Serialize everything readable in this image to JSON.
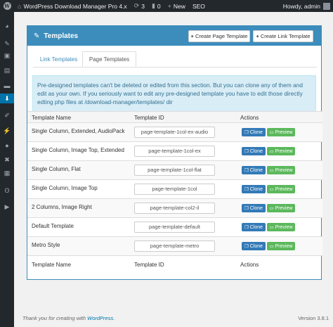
{
  "adminbar": {
    "site_title": "WordPress Download Manager Pro 4.x",
    "updates_count": "3",
    "comments_count": "0",
    "new_label": "New",
    "seo_label": "SEO",
    "howdy": "Howdy, admin"
  },
  "sidemenu": {
    "icons": [
      "dashboard-icon",
      "pin-icon",
      "media-icon",
      "pages-icon",
      "comments-icon",
      "download-manager-icon",
      "appearance-icon",
      "plugins-icon",
      "users-icon",
      "tools-icon",
      "settings-icon",
      "seo-icon",
      "collapse-icon"
    ]
  },
  "panel": {
    "title": "Templates",
    "create_page_template": "Create Page Template",
    "create_link_template": "Create Link Template"
  },
  "tabs": {
    "link_templates": "Link Templates",
    "page_templates": "Page Templates"
  },
  "info": {
    "text": "Pre-designed templates can't be deleted or edited from this section. But you can clone any of them and edit as your own. If you seriously want to edit any pre-designed template you have to edit those directly edting php files at /download-manager/templates/ dir"
  },
  "table": {
    "headers": {
      "name": "Template Name",
      "id": "Template ID",
      "actions": "Actions"
    },
    "clone_label": "Clone",
    "preview_label": "Preview",
    "rows": [
      {
        "name": "Single Column, Extended, AudioPack",
        "id": "page-template-1col-ex-audio"
      },
      {
        "name": "Single Column, Image Top, Extended",
        "id": "page-template-1col-ex"
      },
      {
        "name": "Single Column, Flat",
        "id": "page-template-1col-flat"
      },
      {
        "name": "Single Column, Image Top",
        "id": "page-template-1col"
      },
      {
        "name": "2 Columns, Image Right",
        "id": "page-template-col2-il"
      },
      {
        "name": "Default Template",
        "id": "page-template-default"
      },
      {
        "name": "Metro Style",
        "id": "page-template-metro"
      }
    ]
  },
  "footer": {
    "thanks_prefix": "Thank you for creating with ",
    "thanks_link": "WordPress",
    "thanks_suffix": ".",
    "version": "Version 3.8.1"
  },
  "colors": {
    "accent": "#3c8dbc",
    "clone": "#337ab7",
    "preview": "#5cb85c",
    "info_bg": "#d9edf7"
  }
}
